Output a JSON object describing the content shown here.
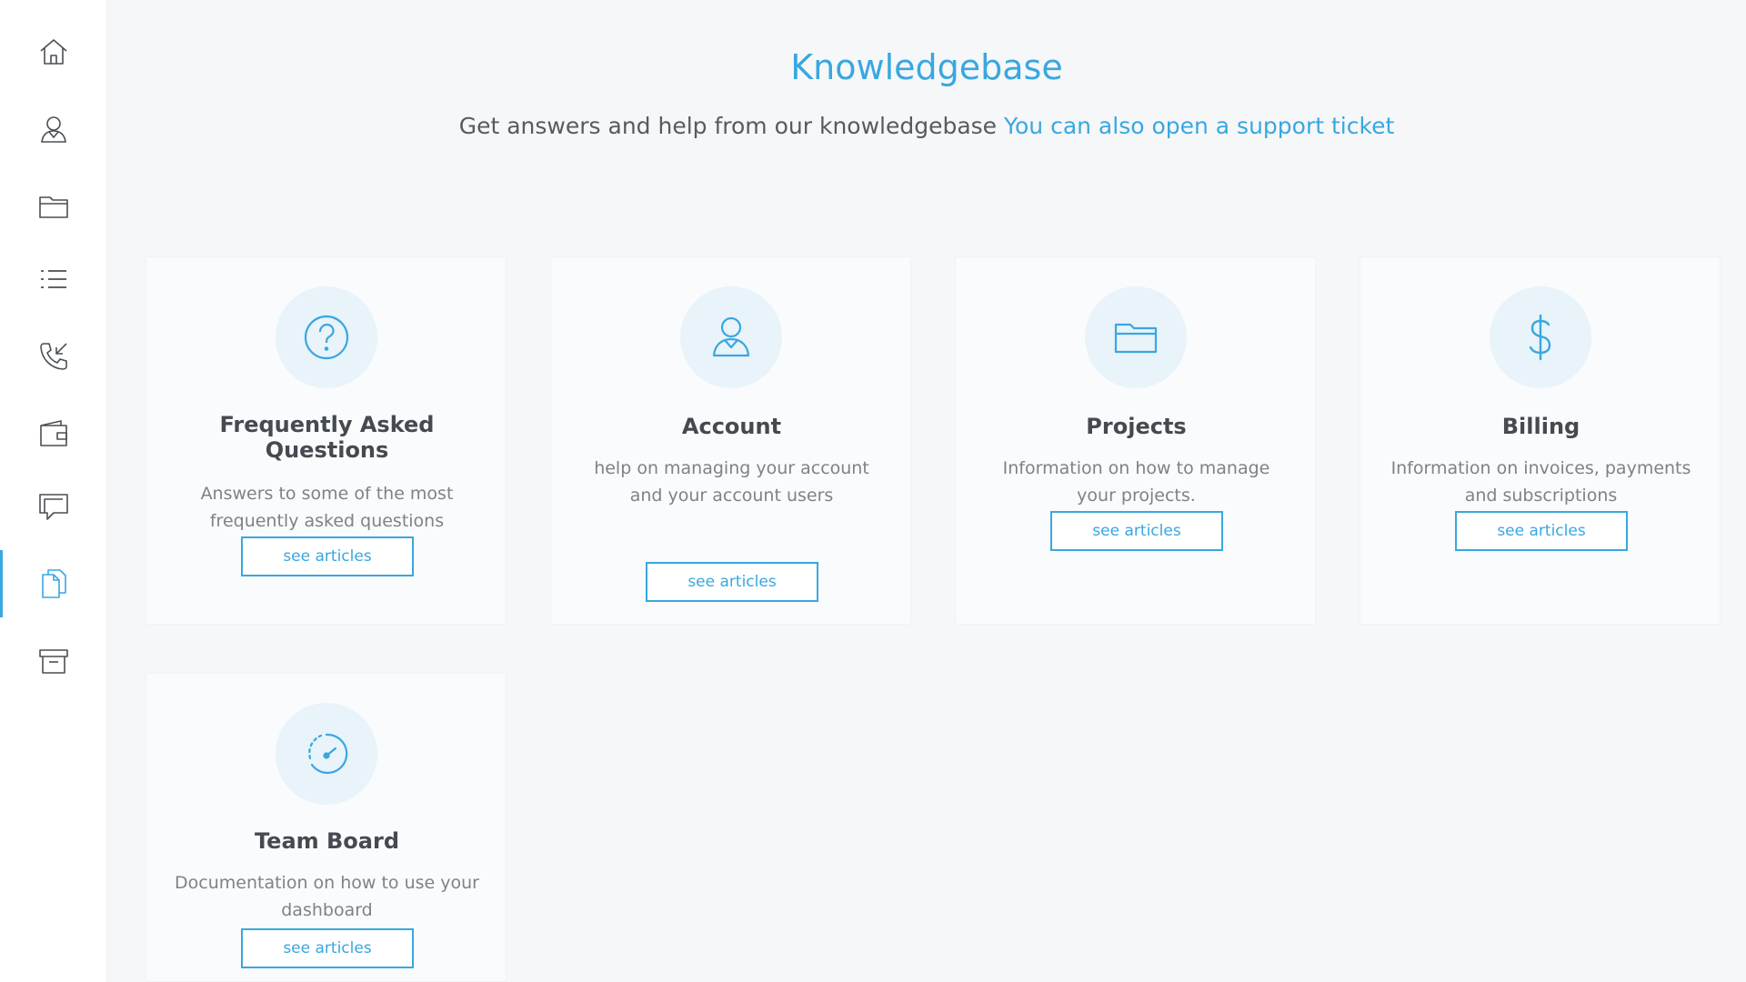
{
  "header": {
    "title": "Knowledgebase",
    "subtitle": "Get answers and help from our knowledgebase",
    "support_link": "You can also open a support ticket"
  },
  "sidebar": {
    "active": "docs",
    "items": [
      {
        "id": "home",
        "icon": "home-icon"
      },
      {
        "id": "users",
        "icon": "user-icon"
      },
      {
        "id": "projects",
        "icon": "folder-icon"
      },
      {
        "id": "list",
        "icon": "list-icon"
      },
      {
        "id": "calls",
        "icon": "phone-icon"
      },
      {
        "id": "wallet",
        "icon": "wallet-icon"
      },
      {
        "id": "messages",
        "icon": "chat-icon"
      },
      {
        "id": "docs",
        "icon": "documents-icon"
      },
      {
        "id": "archive",
        "icon": "archive-icon"
      }
    ]
  },
  "cards": [
    {
      "title": "Frequently Asked Questions",
      "description": "Answers to some of the most frequently asked questions",
      "button": "see articles",
      "icon": "question-icon"
    },
    {
      "title": "Account",
      "description": "help on managing your account and your account users",
      "button": "see articles",
      "icon": "account-icon"
    },
    {
      "title": "Projects",
      "description": "Information on how to manage your projects.",
      "button": "see articles",
      "icon": "folder-icon"
    },
    {
      "title": "Billing",
      "description": "Information on invoices, payments and subscriptions",
      "button": "see articles",
      "icon": "dollar-icon"
    },
    {
      "title": "Team Board",
      "description": "Documentation on how to use your dashboard",
      "button": "see articles",
      "icon": "dashboard-icon"
    }
  ],
  "colors": {
    "accent": "#39a7e0",
    "icon_gray": "#4a4f55",
    "icon_circle": "#e8f3fa"
  }
}
